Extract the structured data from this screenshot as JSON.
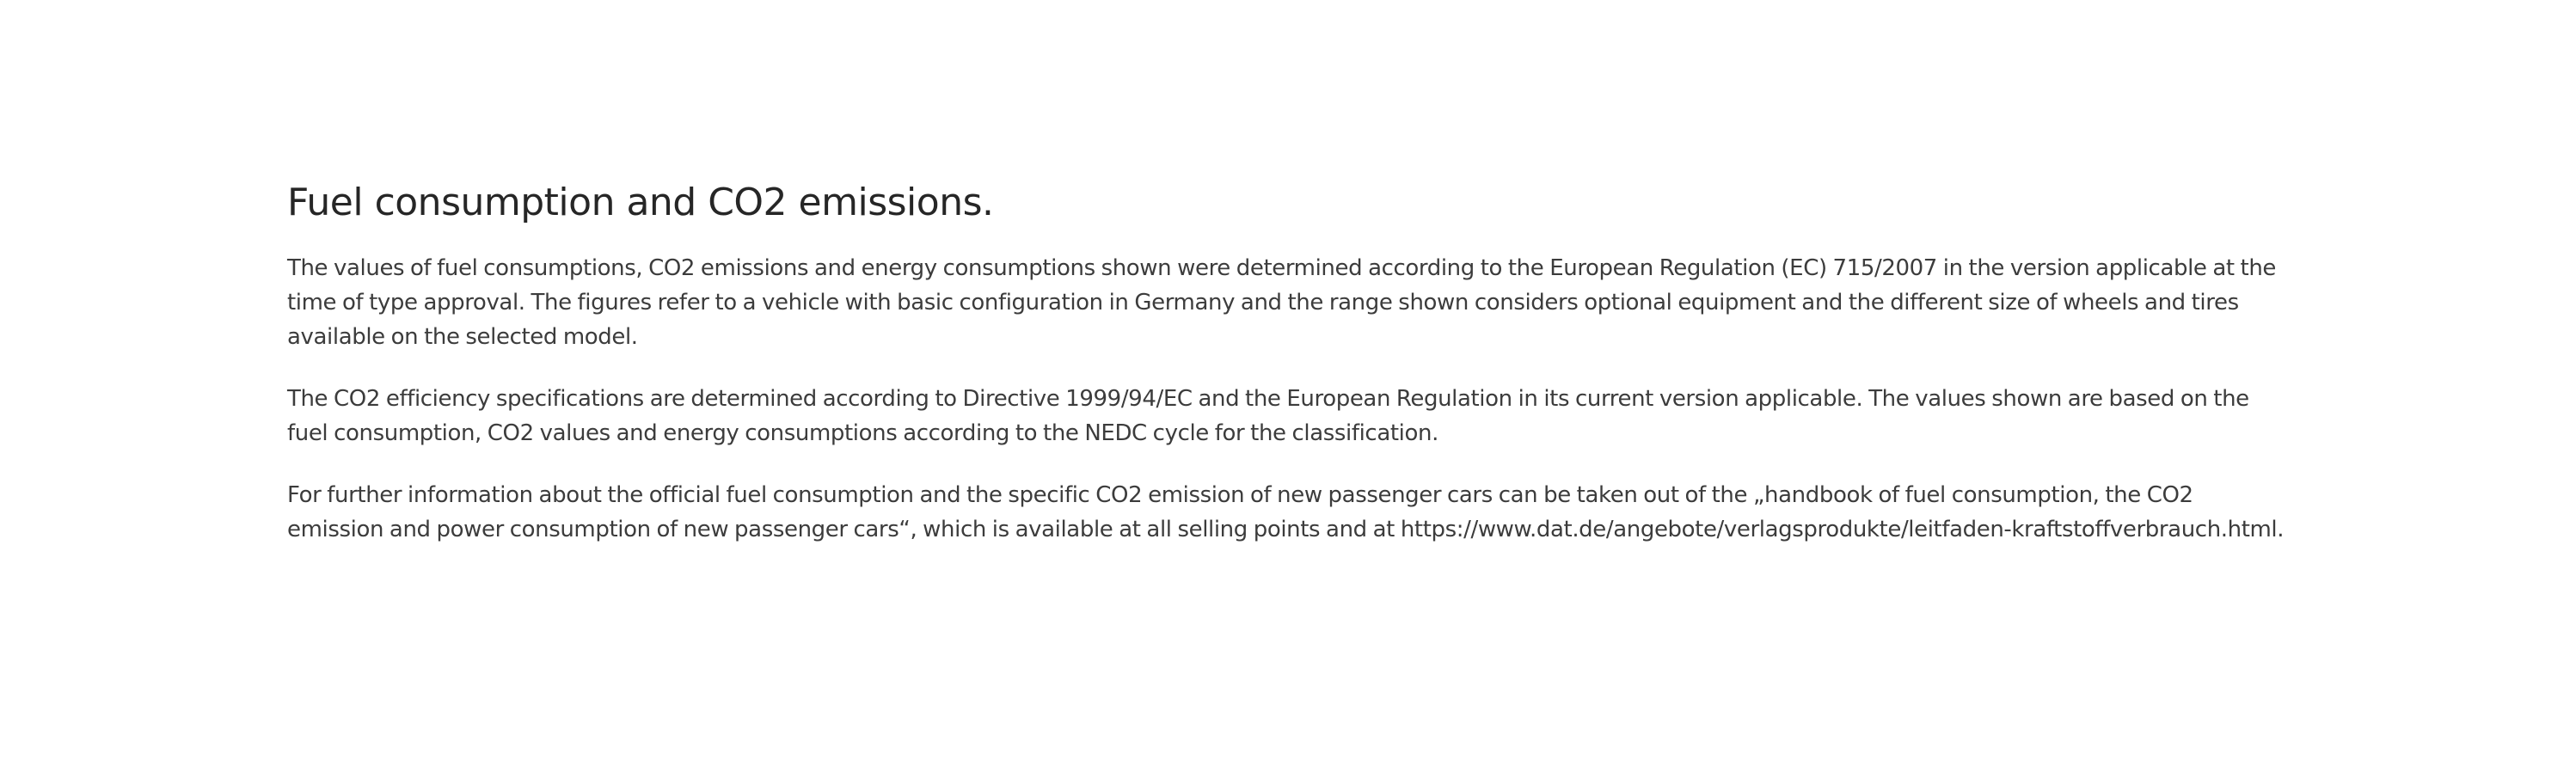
{
  "section": {
    "title": "Fuel consumption and CO2 emissions.",
    "paragraphs": [
      "The values of fuel consumptions, CO2 emissions and energy consumptions shown were determined according to the European Regulation (EC) 715/2007 in the version applicable at the time of type approval. The figures refer to a vehicle with basic configuration in Germany and the range shown considers optional equipment and the different size of wheels and tires available on the selected model.",
      "The CO2 efficiency specifications are determined according to Directive 1999/94/EC and the European Regulation in its current version applicable. The values shown are based on the fuel consumption, CO2 values and energy consumptions according to the NEDC cycle for the classification.",
      "For further information about the official fuel consumption and the specific CO2 emission of new passenger cars can be taken out of the „handbook of fuel consumption, the CO2 emission and power consumption of new passenger cars“, which is available at all selling points and at https://www.dat.de/angebote/verlagsprodukte/leitfaden-kraftstoffverbrauch.html."
    ]
  }
}
